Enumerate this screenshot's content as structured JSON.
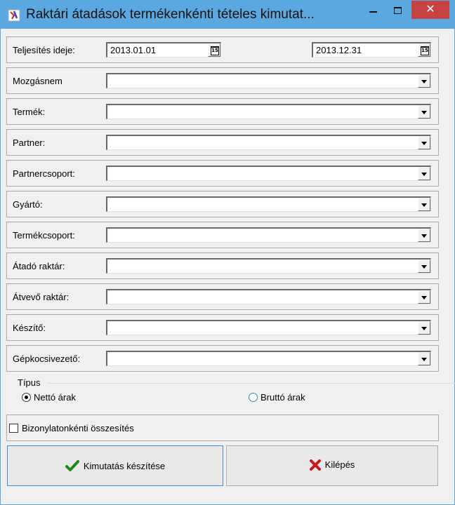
{
  "window": {
    "title": "Raktári átadások termékenkénti tételes kimutat...",
    "close_symbol": "✕"
  },
  "date_row": {
    "label": "Teljesítés ideje:",
    "from": "2013.01.01",
    "to": "2013.12.31",
    "calendar_glyph": "15"
  },
  "filters": [
    {
      "label": "Mozgásnem",
      "value": ""
    },
    {
      "label": "Termék:",
      "value": ""
    },
    {
      "label": "Partner:",
      "value": ""
    },
    {
      "label": "Partnercsoport:",
      "value": ""
    },
    {
      "label": "Gyártó:",
      "value": ""
    },
    {
      "label": "Termékcsoport:",
      "value": ""
    },
    {
      "label": "Átadó raktár:",
      "value": ""
    },
    {
      "label": "Átvevő raktár:",
      "value": ""
    },
    {
      "label": "Készítő:",
      "value": ""
    },
    {
      "label": "Gépkocsivezető:",
      "value": ""
    }
  ],
  "tipus": {
    "legend": "Típus",
    "options": [
      {
        "label": "Nettó árak",
        "checked": true
      },
      {
        "label": "Bruttó árak",
        "checked": false
      }
    ]
  },
  "summary_checkbox": {
    "label": "Bizonylatonkénti összesítés",
    "checked": false
  },
  "buttons": {
    "create": "Kimutatás készítése",
    "exit": "Kilépés"
  },
  "colors": {
    "titlebar": "#5ba8e0",
    "close": "#c74343",
    "check_green": "#1e8a1e",
    "exit_red": "#c81818"
  }
}
